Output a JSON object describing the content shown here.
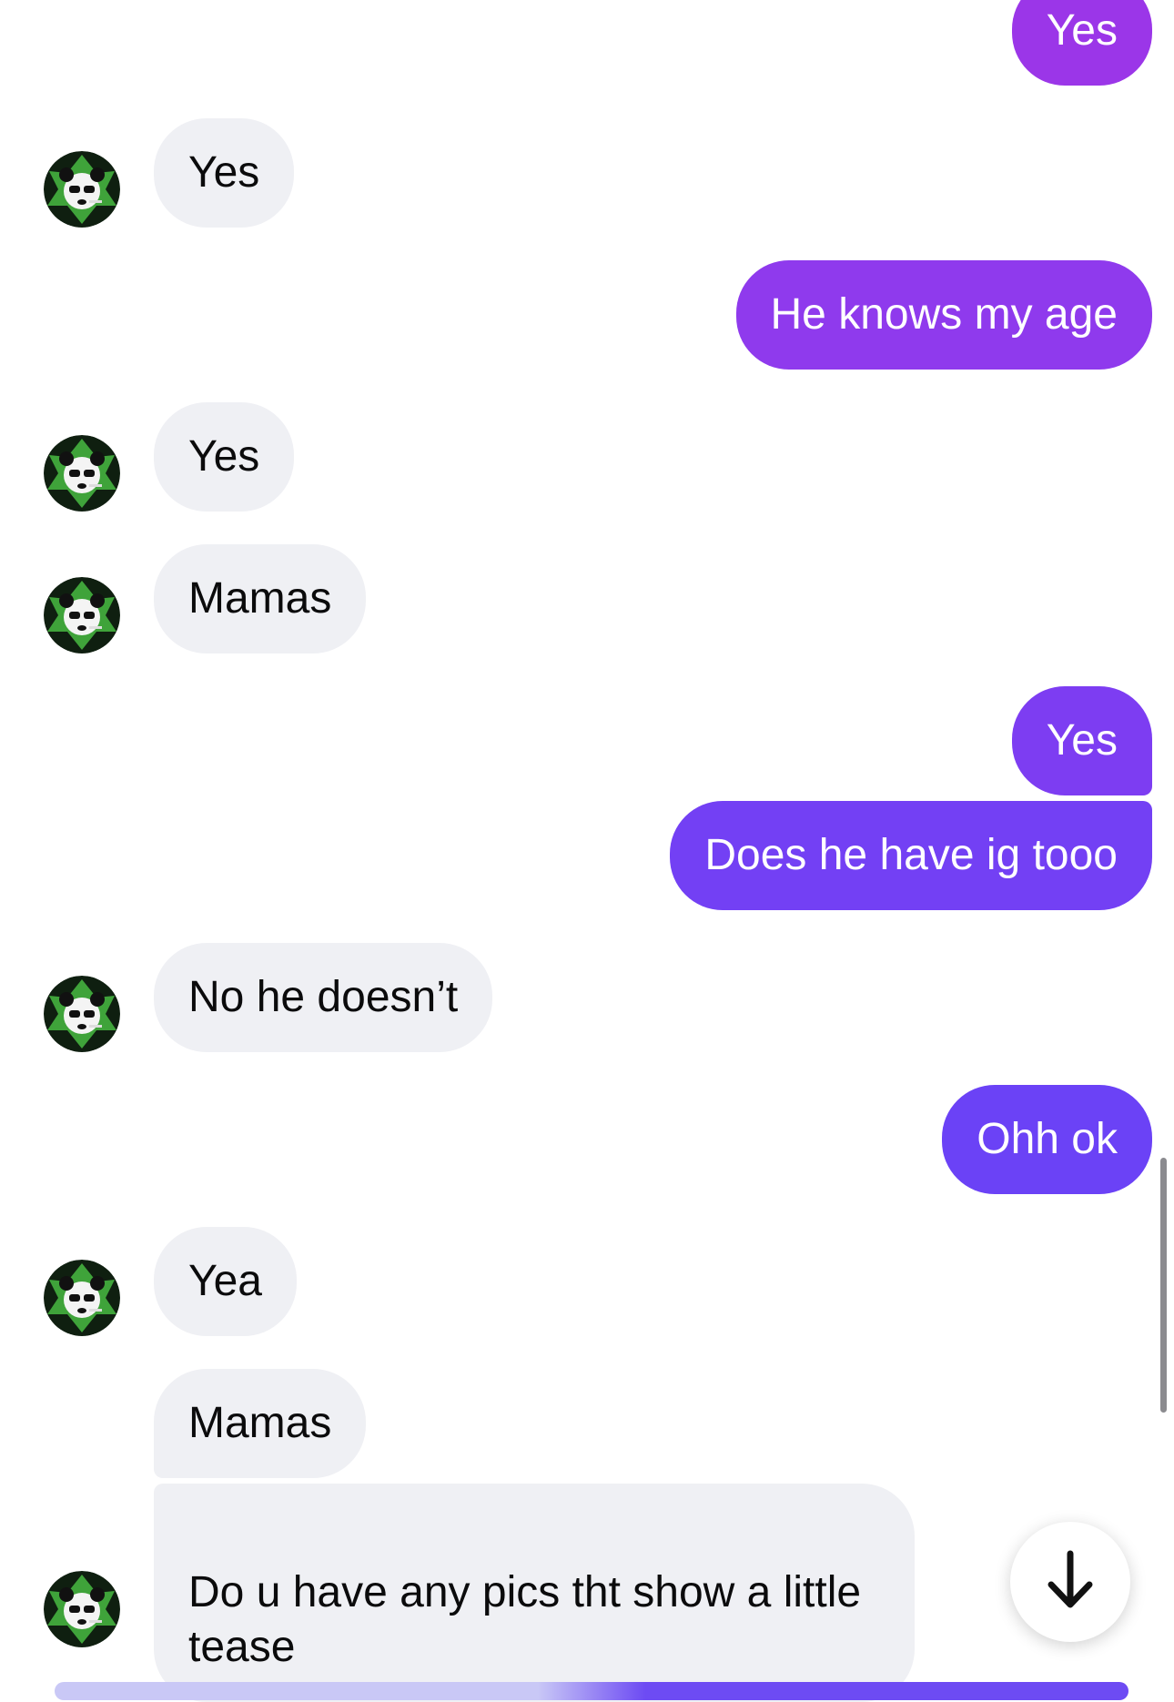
{
  "messages": [
    {
      "id": "m1",
      "dir": "out",
      "text": "Yes",
      "color": "#9b36e8"
    },
    {
      "id": "m2",
      "dir": "in",
      "text": "Yes",
      "avatar": true
    },
    {
      "id": "m3",
      "dir": "out",
      "text": "He knows my age",
      "color": "#8f3aed"
    },
    {
      "id": "m4",
      "dir": "in",
      "text": "Yes",
      "avatar": true
    },
    {
      "id": "m5",
      "dir": "in",
      "text": "Mamas",
      "avatar": true
    },
    {
      "id": "m6",
      "dir": "out",
      "text": "Yes",
      "color": "#7d3df2"
    },
    {
      "id": "m7",
      "dir": "out",
      "text": "Does he have ig tooo",
      "color": "#7340f4"
    },
    {
      "id": "m8",
      "dir": "in",
      "text": "No he doesn’t",
      "avatar": true
    },
    {
      "id": "m9",
      "dir": "out",
      "text": "Ohh ok",
      "color": "#6b42f6"
    },
    {
      "id": "m10",
      "dir": "in",
      "text": "Yea",
      "avatar": true
    },
    {
      "id": "m11",
      "dir": "in",
      "text": "Mamas",
      "avatar": false
    },
    {
      "id": "m12",
      "dir": "in",
      "text": "Do u have any pics tht show a little\ntease",
      "avatar": true
    }
  ],
  "jump_button": {
    "icon": "arrow-down-icon"
  },
  "colors": {
    "incoming_bubble": "#eff0f4",
    "avatar_leaf": "#3fa33a"
  }
}
